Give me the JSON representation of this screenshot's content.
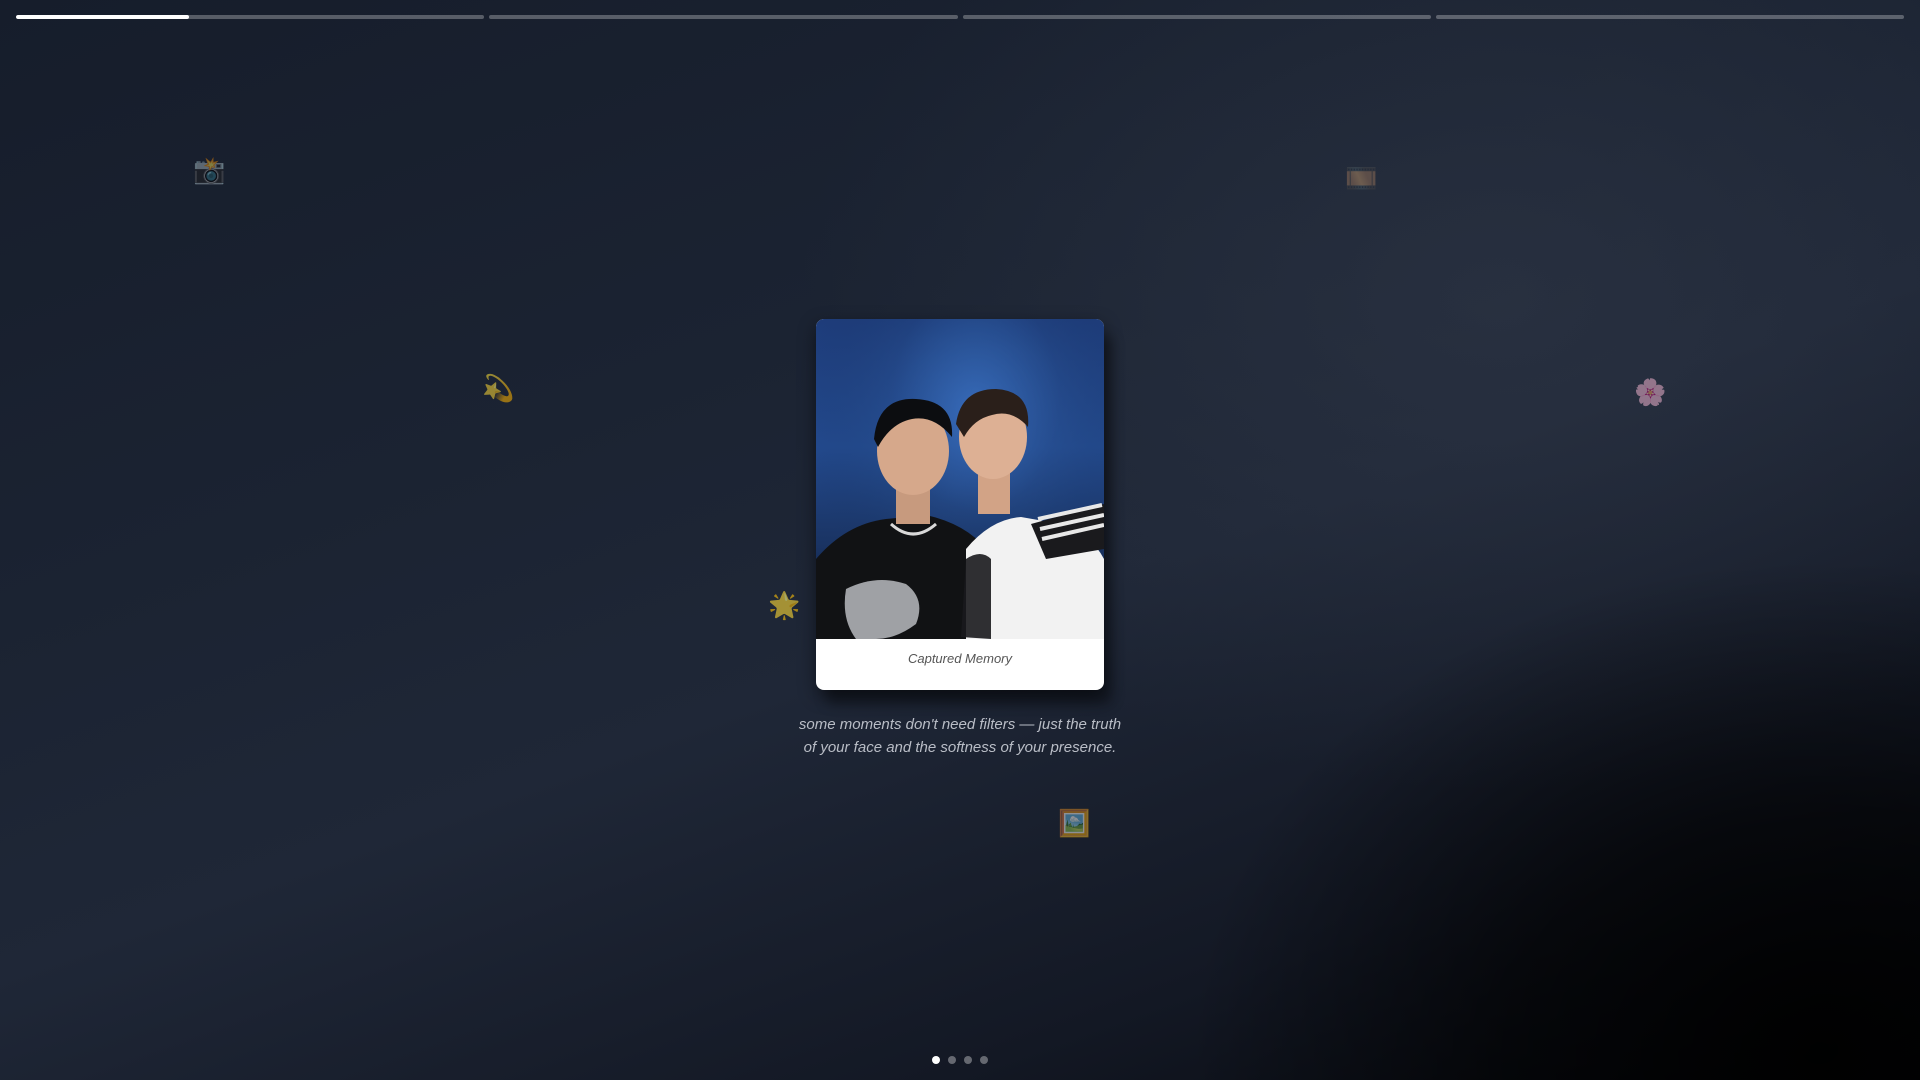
{
  "story": {
    "segment_count": 4,
    "current_segment": 0,
    "current_progress": 0.37
  },
  "decorations": [
    {
      "icon": "camera-emoji",
      "glyph": "📸"
    },
    {
      "icon": "film-emoji",
      "glyph": "🎞️"
    },
    {
      "icon": "dizzy-star-emoji",
      "glyph": "💫"
    },
    {
      "icon": "flower-emoji",
      "glyph": "🌸"
    },
    {
      "icon": "star-emoji",
      "glyph": "🌟"
    },
    {
      "icon": "framed-picture-emoji",
      "glyph": "🖼️"
    }
  ],
  "card": {
    "caption": "Captured Memory"
  },
  "quote": {
    "line1": "some moments don't need filters — just the truth",
    "line2": "of your face and the softness of your presence."
  },
  "pagination": {
    "total": 4,
    "active": 0
  },
  "colors": {
    "accent": "#ffffff",
    "photo_bg": "#234a8e"
  }
}
